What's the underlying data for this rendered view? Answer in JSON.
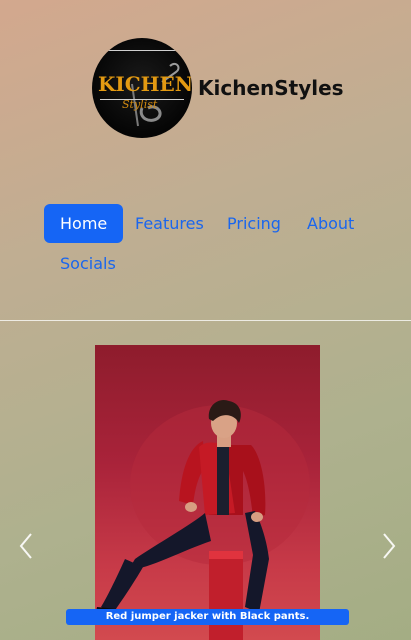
{
  "brand": {
    "logo_word": "KICHEN",
    "logo_script": "Stylist",
    "name": "KichenStyles"
  },
  "nav": {
    "items": [
      {
        "label": "Home",
        "active": true
      },
      {
        "label": "Features"
      },
      {
        "label": "Pricing"
      },
      {
        "label": "About"
      },
      {
        "label": "Socials"
      }
    ]
  },
  "carousel": {
    "caption": "Red jumper jacker with Black pants.",
    "prev_icon": "chevron-left-icon",
    "next_icon": "chevron-right-icon"
  },
  "colors": {
    "accent": "#1565f5",
    "logo_gold": "#e39a12"
  }
}
